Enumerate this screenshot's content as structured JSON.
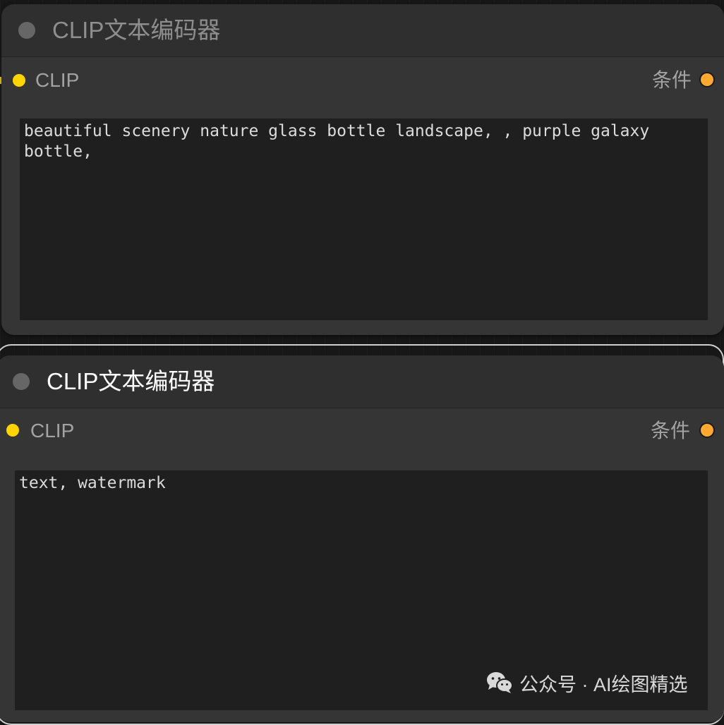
{
  "nodes": [
    {
      "title": "CLIP文本编码器",
      "input_label": "CLIP",
      "output_label": "条件",
      "text": "beautiful scenery nature glass bottle landscape, , purple galaxy bottle,"
    },
    {
      "title": "CLIP文本编码器",
      "input_label": "CLIP",
      "output_label": "条件",
      "text": "text, watermark"
    }
  ],
  "colors": {
    "clip_slot": "#ffd500",
    "conditioning_slot": "#ffa931",
    "node_bg": "#353535",
    "textarea_bg": "#1f1f1f"
  },
  "watermark": {
    "text": "公众号 · AI绘图精选",
    "icon": "wechat-icon"
  }
}
